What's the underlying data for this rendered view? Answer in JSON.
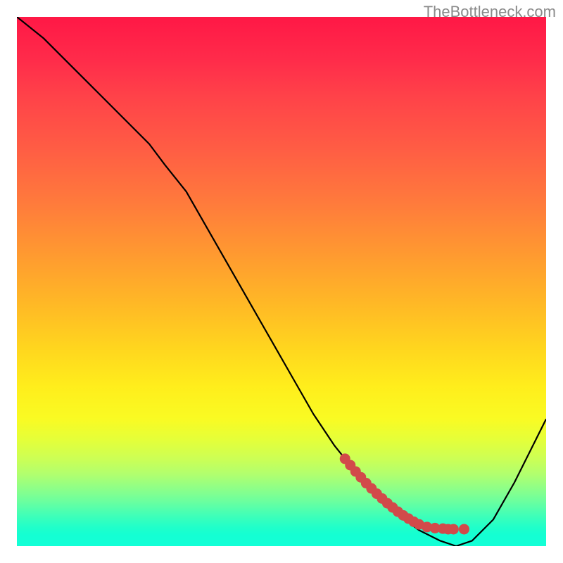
{
  "attribution": "TheBottleneck.com",
  "chart_data": {
    "type": "line",
    "title": "",
    "xlabel": "",
    "ylabel": "",
    "xlim": [
      0,
      100
    ],
    "ylim": [
      0,
      100
    ],
    "grid": false,
    "series": [
      {
        "name": "curve",
        "color": "#000000",
        "x": [
          0,
          5,
          10,
          15,
          20,
          25,
          28,
          32,
          36,
          40,
          44,
          48,
          52,
          56,
          60,
          64,
          68,
          72,
          76,
          80,
          83,
          86,
          90,
          94,
          98,
          100
        ],
        "y": [
          100,
          96,
          91,
          86,
          81,
          76,
          72,
          67,
          60,
          53,
          46,
          39,
          32,
          25,
          19,
          14,
          10,
          6,
          3,
          1,
          0,
          1,
          5,
          12,
          20,
          24
        ]
      },
      {
        "name": "highlight-dots",
        "color": "#d24a4a",
        "type": "scatter",
        "x": [
          62,
          63,
          64,
          65,
          66,
          67,
          68,
          69,
          70,
          71,
          72,
          73,
          74,
          75,
          76,
          77.5,
          79,
          80.5,
          81.5,
          82.5,
          84.5
        ],
        "y": [
          16.5,
          15.3,
          14.1,
          13.0,
          11.9,
          10.9,
          9.9,
          9.0,
          8.1,
          7.3,
          6.5,
          5.8,
          5.2,
          4.6,
          4.1,
          3.6,
          3.4,
          3.3,
          3.2,
          3.2,
          3.2
        ]
      }
    ],
    "notes": "Axes have no visible ticks or labels. Background is a vertical rainbow gradient (red → green). Values are estimated from pixel positions."
  }
}
